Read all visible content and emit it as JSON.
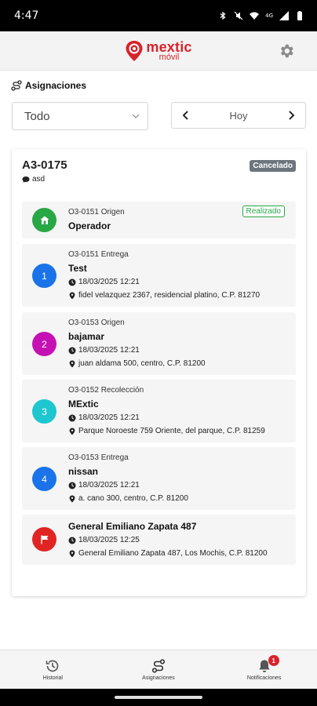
{
  "status_bar": {
    "time": "4:47",
    "network": "4G"
  },
  "app": {
    "logo_text": "mextic",
    "logo_subtext": "móvil",
    "brand_color": "#d8232a"
  },
  "section": {
    "title": "Asignaciones"
  },
  "filter": {
    "selected": "Todo"
  },
  "date_nav": {
    "label": "Hoy"
  },
  "assignment": {
    "id": "A3-0175",
    "note": "asd",
    "status": "Cancelado",
    "stops": [
      {
        "ref": "O3-0151 Origen",
        "name": "Operador",
        "badge": "Realizado",
        "marker": "house-icon",
        "color": "#28a745"
      },
      {
        "ref": "O3-0151 Entrega",
        "name": "Test",
        "number": "1",
        "datetime": "18/03/2025 12:21",
        "address": "fidel velazquez 2367, residencial platino, C.P. 81270",
        "color": "#1a73e8"
      },
      {
        "ref": "O3-0153 Origen",
        "name": "bajamar",
        "number": "2",
        "datetime": "18/03/2025 12:21",
        "address": "juan aldama 500, centro, C.P. 81200",
        "color": "#c511b4"
      },
      {
        "ref": "O3-0152 Recolección",
        "name": "MExtic",
        "number": "3",
        "datetime": "18/03/2025 12:21",
        "address": "Parque Noroeste 759 Oriente, del parque, C.P. 81259",
        "color": "#1ec6cf"
      },
      {
        "ref": "O3-0153 Entrega",
        "name": "nissan",
        "number": "4",
        "datetime": "18/03/2025 12:21",
        "address": "a. cano 300, centro, C.P. 81200",
        "color": "#1a73e8"
      },
      {
        "name": "General Emiliano Zapata 487",
        "datetime": "18/03/2025 12:25",
        "address": "General Emiliano Zapata 487, Los Mochis, C.P. 81200",
        "marker": "flag-icon",
        "color": "#e02424"
      }
    ]
  },
  "bottom_nav": {
    "items": [
      {
        "label": "Historial",
        "icon": "history-icon"
      },
      {
        "label": "Asignaciones",
        "icon": "route-icon"
      },
      {
        "label": "Notificaciones",
        "icon": "bell-icon",
        "count": "1"
      }
    ]
  }
}
